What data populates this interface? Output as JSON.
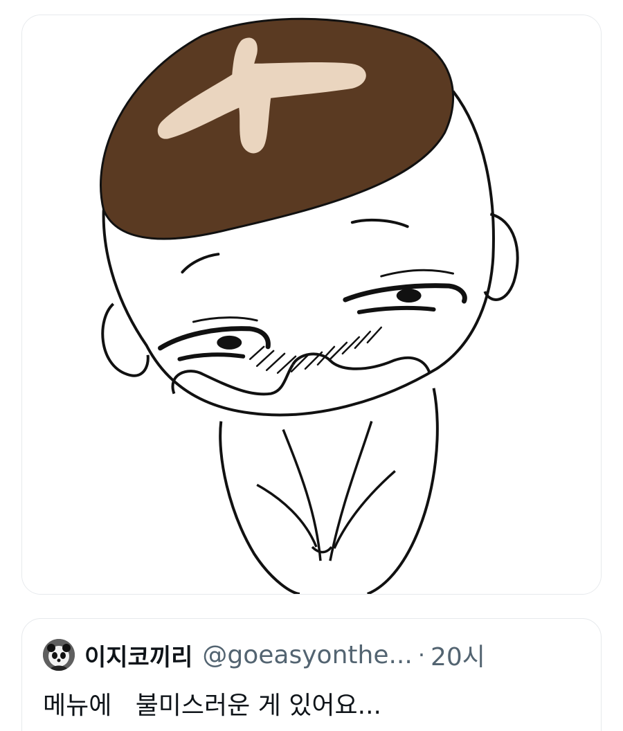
{
  "quoted_tweet": {
    "avatar_icon": "panda-avatar-icon",
    "display_name": "이지코끼리",
    "handle": "@goeasyonthe...",
    "separator": "·",
    "time": "20시",
    "text": "메뉴에   불미스러운 게 있어요..."
  },
  "media": {
    "image_icon": "mushroom-head-character-illustration",
    "colors": {
      "cap": "#5a3a22",
      "cross": "#ead5bf",
      "line": "#111111"
    }
  }
}
